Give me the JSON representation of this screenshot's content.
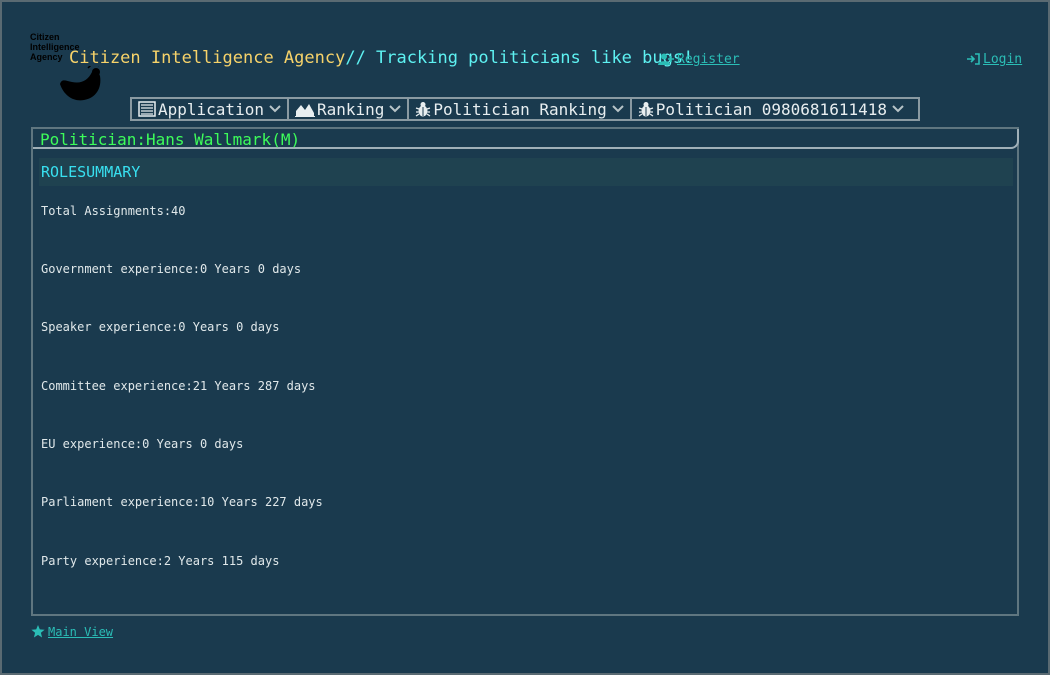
{
  "header": {
    "logo_text": "Citizen Intelligence Agency",
    "title_part1": "Citizen Intelligence Agency",
    "title_part2": "// Tracking politicians like bugs!",
    "register_label": "Register",
    "login_label": "Login"
  },
  "menu": [
    {
      "label": "Application",
      "icon": "list-icon"
    },
    {
      "label": "Ranking",
      "icon": "area-chart-icon"
    },
    {
      "label": "Politician Ranking",
      "icon": "bug-icon"
    },
    {
      "label": "Politician 0980681611418",
      "icon": "bug-icon"
    }
  ],
  "panel": {
    "header": "Politician:Hans Wallmark(M)",
    "section_title": "ROLESUMMARY",
    "lines": [
      "Total Assignments:40",
      "Government experience:0 Years 0 days",
      "Speaker experience:0 Years 0 days",
      "Committee experience:21 Years 287 days",
      "EU experience:0 Years 0 days",
      "Parliament experience:10 Years 227 days",
      "Party experience:2 Years 115 days"
    ]
  },
  "footer": {
    "main_view_label": "Main View"
  },
  "colors": {
    "background": "#1a3a4e",
    "title_yellow": "#f7d36a",
    "title_cyan": "#5ef2f2",
    "link": "#2bbdb6",
    "politician_green": "#3dfc5a"
  }
}
